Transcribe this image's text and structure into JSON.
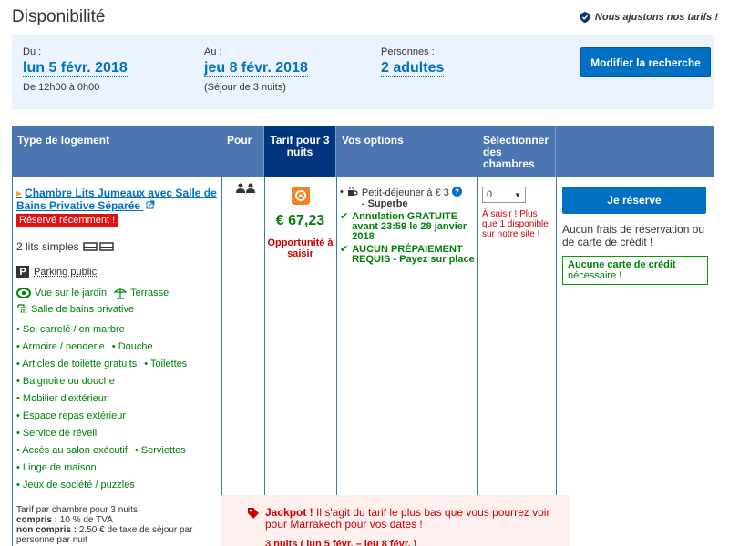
{
  "header": {
    "title": "Disponibilité",
    "note": "Nous ajustons nos tarifs !"
  },
  "search": {
    "checkin_label": "Du :",
    "checkin_value": "lun 5 févr. 2018",
    "checkin_sub": "De 12h00 à 0h00",
    "checkout_label": "Au :",
    "checkout_value": "jeu 8 févr. 2018",
    "checkout_sub": "(Séjour de 3 nuits)",
    "persons_label": "Personnes :",
    "persons_value": "2 adultes",
    "modify_button": "Modifier la recherche"
  },
  "table": {
    "headers": {
      "type": "Type de logement",
      "pour": "Pour",
      "tarif": "Tarif pour 3 nuits",
      "options": "Vos options",
      "select": "Sélectionner des chambres"
    },
    "room": {
      "name": "Chambre Lits Jumeaux avec Salle de Bains Privative Séparée",
      "badge": "Réservé récemment !",
      "beds": "2 lits simples",
      "parking": "Parking public",
      "feat_garden": "Vue sur le jardin",
      "feat_terrace": "Terrasse",
      "feat_bath": "Salle de bains privative",
      "features": [
        "• Sol carrelé / en marbre",
        "• Armoire / penderie",
        "• Articles de toilette gratuits",
        "• Baignoire ou douche",
        "• Mobilier d'extérieur",
        "• Espace repas extérieur",
        "• Service de réveil",
        "• Accès au salon exécutif",
        "• Linge de maison",
        "• Jeux de société / puzzles"
      ],
      "features_extra": {
        "1": "• Douche",
        "2": "• Toilettes",
        "7": "• Serviettes"
      },
      "tarif_note_line1": "Tarif par chambre pour 3 nuits",
      "tarif_note_included_label": "compris :",
      "tarif_note_included": "10 % de TVA",
      "tarif_note_excluded_label": "non compris :",
      "tarif_note_excluded": "2,50 € de taxe de séjour par personne par nuit"
    },
    "price": "€ 67,23",
    "opportunity": "Opportunité à saisir",
    "options": {
      "breakfast": "Petit-déjeuner à € 3",
      "breakfast_quality": "- Superbe",
      "cancellation": "Annulation GRATUITE avant 23:59 le 28 janvier 2018",
      "prepayment": "AUCUN PRÉPAIEMENT REQUIS - Payez sur place"
    },
    "select": {
      "value": "0",
      "note": "À saisir ! Plus que 1 disponible sur notre site !"
    },
    "reserve": {
      "button": "Je réserve",
      "note": "Aucun frais de réservation ou de carte de crédit !",
      "nocard_title": "Aucune carte de crédit",
      "nocard_sub": "nécessaire !"
    }
  },
  "jackpot": {
    "title": "Jackpot !",
    "text": "Il s'agit du tarif le plus bas que vous pourrez voir pour Marrakech pour vos dates !",
    "sub": "3 nuits ( lun 5 févr. – jeu 8 févr. )"
  },
  "colors": {
    "brand_blue": "#0071c2",
    "header_blue": "#4c76b2",
    "dark_blue": "#003580",
    "green": "#008009",
    "red": "#cc0000"
  }
}
